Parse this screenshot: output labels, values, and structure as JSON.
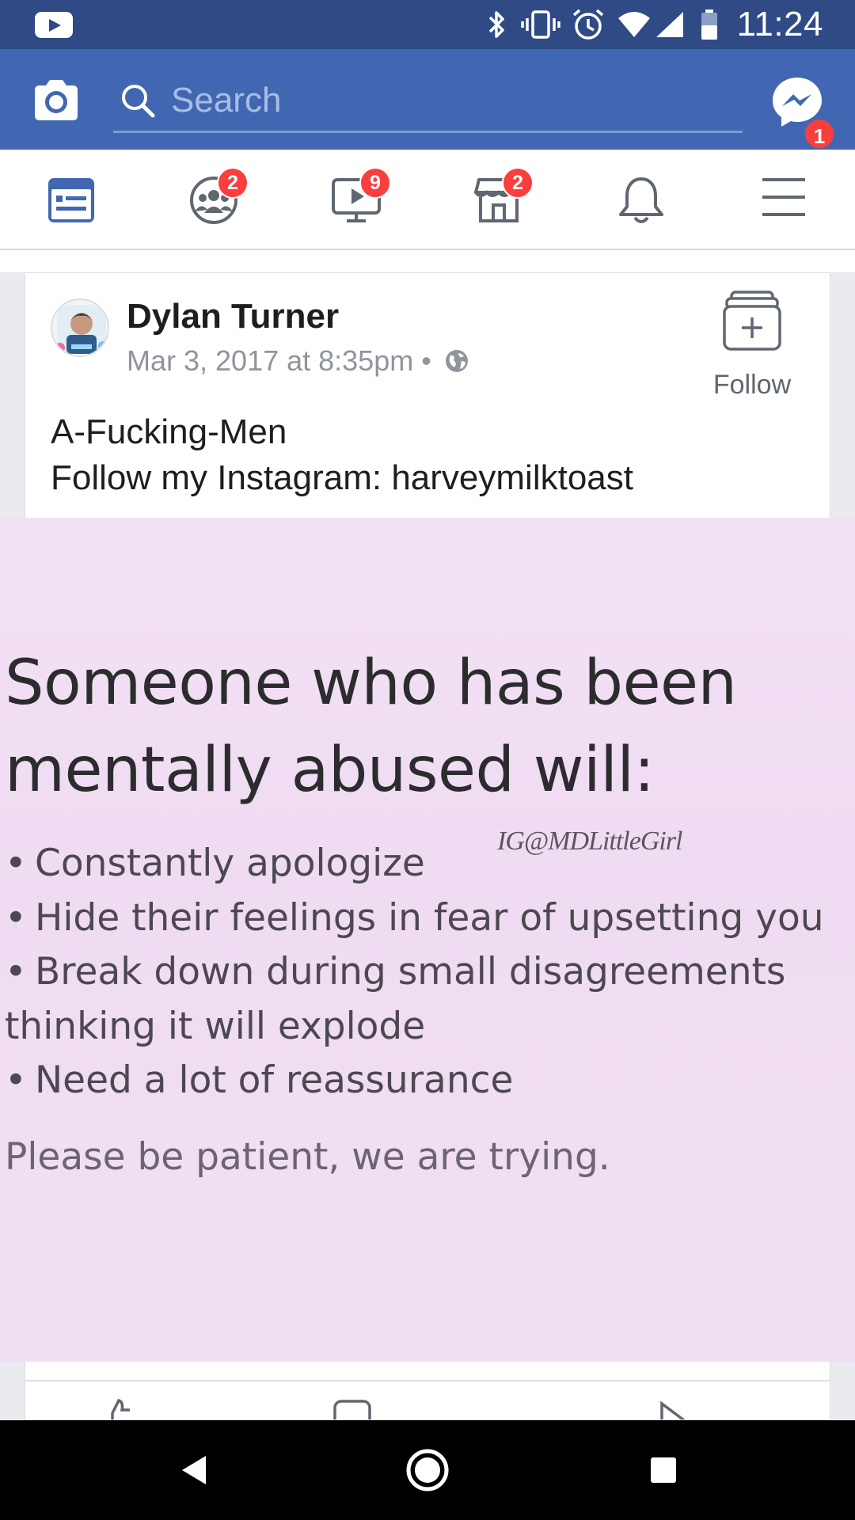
{
  "status_bar": {
    "time": "11:24",
    "icons": [
      "youtube-app-icon",
      "bluetooth-icon",
      "vibrate-icon",
      "alarm-icon",
      "wifi-icon",
      "signal-icon",
      "battery-icon"
    ]
  },
  "header": {
    "search_placeholder": "Search",
    "messenger_badge": "1",
    "brand_color": "#4267b2"
  },
  "tabs": [
    {
      "name": "news-feed",
      "icon": "news-feed-icon",
      "badge": "",
      "active": true
    },
    {
      "name": "groups",
      "icon": "groups-icon",
      "badge": "2",
      "active": false
    },
    {
      "name": "watch",
      "icon": "watch-video-icon",
      "badge": "9",
      "active": false
    },
    {
      "name": "marketplace",
      "icon": "marketplace-icon",
      "badge": "2",
      "active": false
    },
    {
      "name": "notifications",
      "icon": "bell-icon",
      "badge": "",
      "active": false
    },
    {
      "name": "menu",
      "icon": "hamburger-menu-icon",
      "badge": "",
      "active": false
    }
  ],
  "post": {
    "author": "Dylan Turner",
    "timestamp": "Mar 3, 2017 at 8:35pm",
    "separator": "•",
    "privacy_icon": "globe-icon",
    "follow_label": "Follow",
    "text_lines": [
      "A-Fucking-Men",
      "Follow my Instagram: harveymilktoast"
    ],
    "image": {
      "heading_lines": [
        "Someone who has been",
        "mentally abused will:"
      ],
      "watermark": "IG@MDLittleGirl",
      "list_lines": [
        {
          "bullet": "•",
          "text": "Constantly apologize"
        },
        {
          "bullet": "•",
          "text": "Hide their feelings in fear of upsetting you"
        },
        {
          "bullet": "•",
          "text": "Break down during small disagreements"
        },
        {
          "bullet": "",
          "text": "thinking it will explode"
        },
        {
          "bullet": "•",
          "text": "Need a lot of reassurance"
        }
      ],
      "footer": "Please be patient, we are trying."
    }
  },
  "nav_bar": {
    "buttons": [
      "back-icon",
      "home-icon",
      "recents-icon"
    ]
  }
}
